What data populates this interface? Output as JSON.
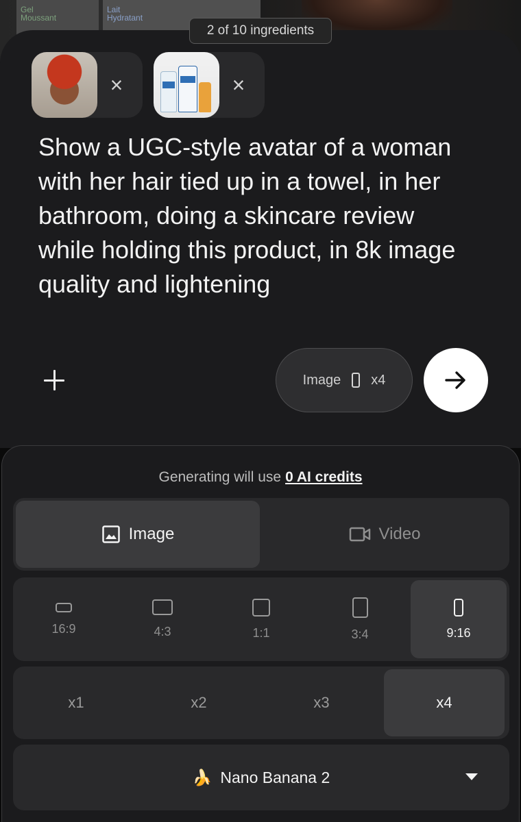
{
  "background": {
    "card_left_lines": [
      "Gel",
      "Moussant"
    ],
    "card_mid_lines": [
      "Lait",
      "Hydratant"
    ]
  },
  "ingredients_counter": "2 of 10 ingredients",
  "attachments": [
    {
      "name": "woman-portrait",
      "close_label": "×"
    },
    {
      "name": "cerave-products",
      "close_label": "×"
    }
  ],
  "prompt": "Show a UGC-style avatar of a woman with her hair tied up in a towel, in her bathroom, doing a skincare review while holding this product, in 8k image quality and lightening",
  "summary_pill": {
    "mode": "Image",
    "count": "x4"
  },
  "settings": {
    "credits_prefix": "Generating will use",
    "credits_value": "0 AI credits",
    "modes": [
      "Image",
      "Video"
    ],
    "selected_mode": "Image",
    "ratios": [
      "16:9",
      "4:3",
      "1:1",
      "3:4",
      "9:16"
    ],
    "selected_ratio": "9:16",
    "counts": [
      "x1",
      "x2",
      "x3",
      "x4"
    ],
    "selected_count": "x4",
    "model": "Nano Banana 2",
    "model_emoji": "🍌"
  },
  "colors": {
    "background": "#0a0a0a",
    "card": "#1b1b1d",
    "selected": "#3b3b3d",
    "submit": "#ffffff"
  }
}
